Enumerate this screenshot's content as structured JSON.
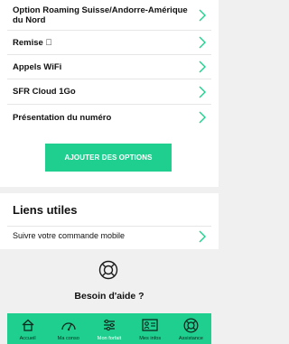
{
  "options": [
    {
      "label": "Option Roaming Suisse/Andorre-Amérique du Nord"
    },
    {
      "label": "Remise \u0000"
    },
    {
      "label": "Appels WiFi"
    },
    {
      "label": "SFR Cloud 1Go"
    },
    {
      "label": "Présentation du numéro"
    }
  ],
  "add_button": {
    "label": "AJOUTER DES OPTIONS"
  },
  "liens": {
    "title": "Liens utiles",
    "items": [
      {
        "label": "Suivre votre commande mobile"
      }
    ]
  },
  "help": {
    "title": "Besoin d'aide ?",
    "icon": "lifebuoy-icon"
  },
  "tabs": [
    {
      "label": "Accueil",
      "icon": "home-icon",
      "active": false
    },
    {
      "label": "Ma conso",
      "icon": "gauge-icon",
      "active": false
    },
    {
      "label": "Mon forfait",
      "icon": "sliders-icon",
      "active": true
    },
    {
      "label": "Mes infos",
      "icon": "id-card-icon",
      "active": false
    },
    {
      "label": "Assistance",
      "icon": "lifebuoy-icon",
      "active": false
    }
  ],
  "colors": {
    "accent": "#1fcf8f",
    "chevron": "#1fcf8f",
    "background": "#f0f0f0"
  }
}
